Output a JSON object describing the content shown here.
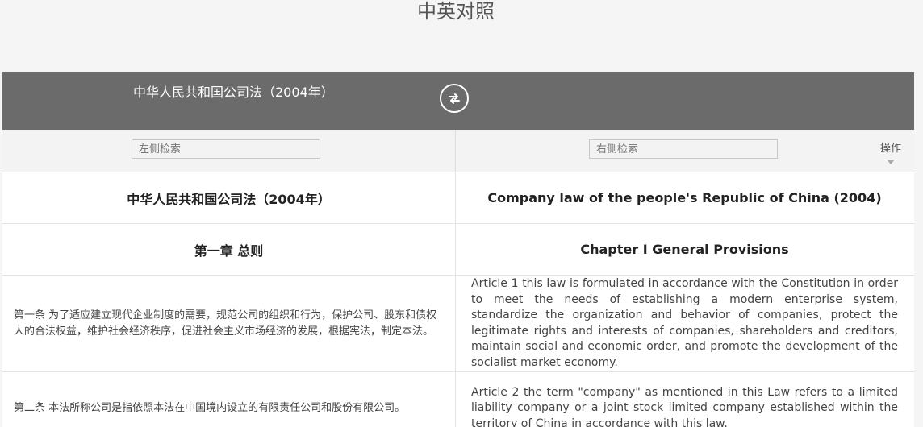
{
  "page_title": "中英对照",
  "header": {
    "doc_title": "中华人民共和国公司法（2004年）"
  },
  "search": {
    "left_placeholder": "左侧检索",
    "right_placeholder": "右侧检索",
    "ops_label": "操作"
  },
  "rows": [
    {
      "left": "中华人民共和国公司法（2004年）",
      "right": "Company law of the people's Republic of China (2004)"
    },
    {
      "left": "第一章 总则",
      "right": "Chapter I General Provisions"
    },
    {
      "left": "第一条 为了适应建立现代企业制度的需要，规范公司的组织和行为，保护公司、股东和债权人的合法权益，维护社会经济秩序，促进社会主义市场经济的发展，根据宪法，制定本法。",
      "right": "Article 1 this law is formulated in accordance with the Constitution in order to meet the needs of establishing a modern enterprise system, standardize the organization and behavior of companies, protect the legitimate rights and interests of companies, shareholders and creditors, maintain social and economic order, and promote the development of the socialist market economy."
    },
    {
      "left": "第二条 本法所称公司是指依照本法在中国境内设立的有限责任公司和股份有限公司。",
      "right": "Article 2 the term \"company\" as mentioned in this Law refers to a limited liability company or a joint stock limited company established within the territory of China in accordance with this law."
    }
  ]
}
